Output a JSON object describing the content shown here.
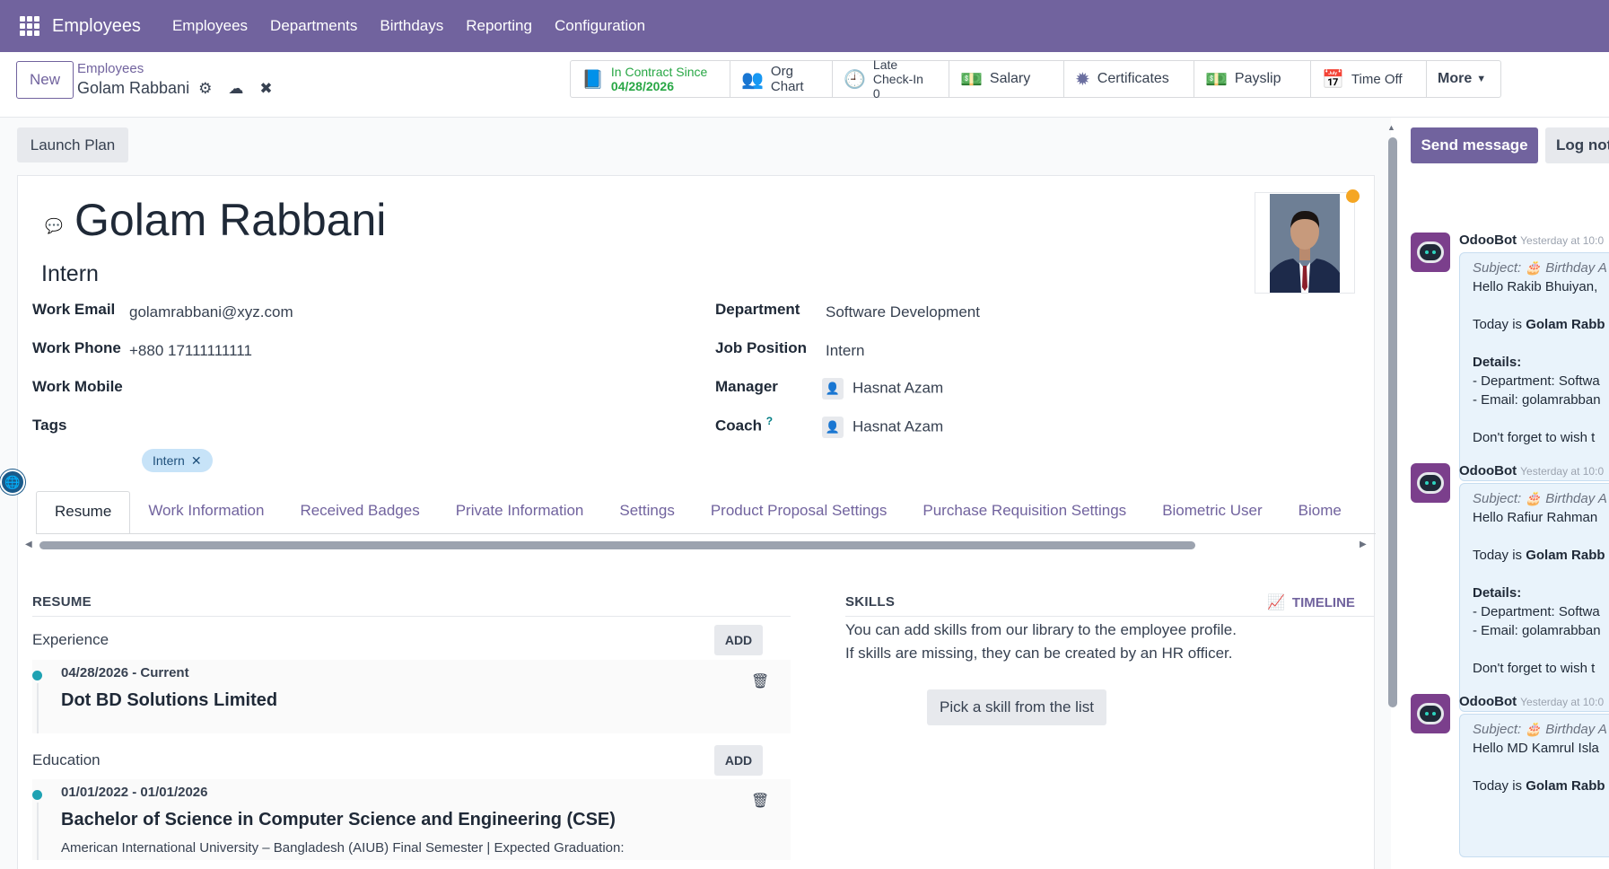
{
  "nav": {
    "brand": "Employees",
    "links": [
      "Employees",
      "Departments",
      "Birthdays",
      "Reporting",
      "Configuration"
    ]
  },
  "control": {
    "new_label": "New",
    "breadcrumb_parent": "Employees",
    "breadcrumb_current": "Golam Rabbani"
  },
  "stats": {
    "contract_label": "In Contract Since",
    "contract_date": "04/28/2026",
    "org_chart": "Org Chart",
    "late_checkin_label": "Late Check-In",
    "late_checkin_value": "0",
    "salary": "Salary",
    "certificates": "Certificates",
    "payslip": "Payslip",
    "time_off": "Time Off",
    "more": "More"
  },
  "form": {
    "launch_plan": "Launch Plan",
    "name": "Golam Rabbani",
    "job_title": "Intern",
    "fields": {
      "work_email_label": "Work Email",
      "work_email": "golamrabbani@xyz.com",
      "work_phone_label": "Work Phone",
      "work_phone": "+880 17111111111",
      "work_mobile_label": "Work Mobile",
      "tags_label": "Tags",
      "tag": "Intern",
      "department_label": "Department",
      "department": "Software Development",
      "job_position_label": "Job Position",
      "job_position": "Intern",
      "manager_label": "Manager",
      "manager": "Hasnat Azam",
      "coach_label": "Coach",
      "coach": "Hasnat Azam",
      "coach_help": "?"
    },
    "tabs": [
      "Resume",
      "Work Information",
      "Received Badges",
      "Private Information",
      "Settings",
      "Product Proposal Settings",
      "Purchase Requisition Settings",
      "Biometric User",
      "Biome"
    ]
  },
  "resume": {
    "title": "RESUME",
    "experience_label": "Experience",
    "education_label": "Education",
    "add_label": "ADD",
    "experience": {
      "date": "04/28/2026 - Current",
      "org": "Dot BD Solutions Limited"
    },
    "education": {
      "date": "01/01/2022 - 01/01/2026",
      "org": "Bachelor of Science in Computer Science and Engineering (CSE)",
      "desc": "American International University – Bangladesh (AIUB) Final Semester | Expected Graduation:"
    }
  },
  "skills": {
    "title": "SKILLS",
    "timeline": "TIMELINE",
    "line1": "You can add skills from our library to the employee profile.",
    "line2": "If skills are missing, they can be created by an HR officer.",
    "pick": "Pick a skill from the list"
  },
  "chatter": {
    "send_message": "Send message",
    "log_note": "Log not",
    "messages": [
      {
        "author": "OdooBot",
        "time": "Yesterday at 10:0",
        "subject": "Subject: 🎂 Birthday A",
        "greeting": "Hello Rakib Bhuiyan,",
        "today": "Today is ",
        "today_name": "Golam Rabb",
        "details": "Details:",
        "dept": "- Department: Softwa",
        "email": "- Email: golamrabban",
        "closing": "Don't forget to wish t"
      },
      {
        "author": "OdooBot",
        "time": "Yesterday at 10:0",
        "subject": "Subject: 🎂 Birthday A",
        "greeting": "Hello Rafiur Rahman",
        "today": "Today is ",
        "today_name": "Golam Rabb",
        "details": "Details:",
        "dept": "- Department: Softwa",
        "email": "- Email: golamrabban",
        "closing": "Don't forget to wish t"
      },
      {
        "author": "OdooBot",
        "time": "Yesterday at 10:0",
        "subject": "Subject: 🎂 Birthday A",
        "greeting": "Hello MD Kamrul Isla",
        "today": "Today is ",
        "today_name": "Golam Rabb"
      }
    ]
  }
}
